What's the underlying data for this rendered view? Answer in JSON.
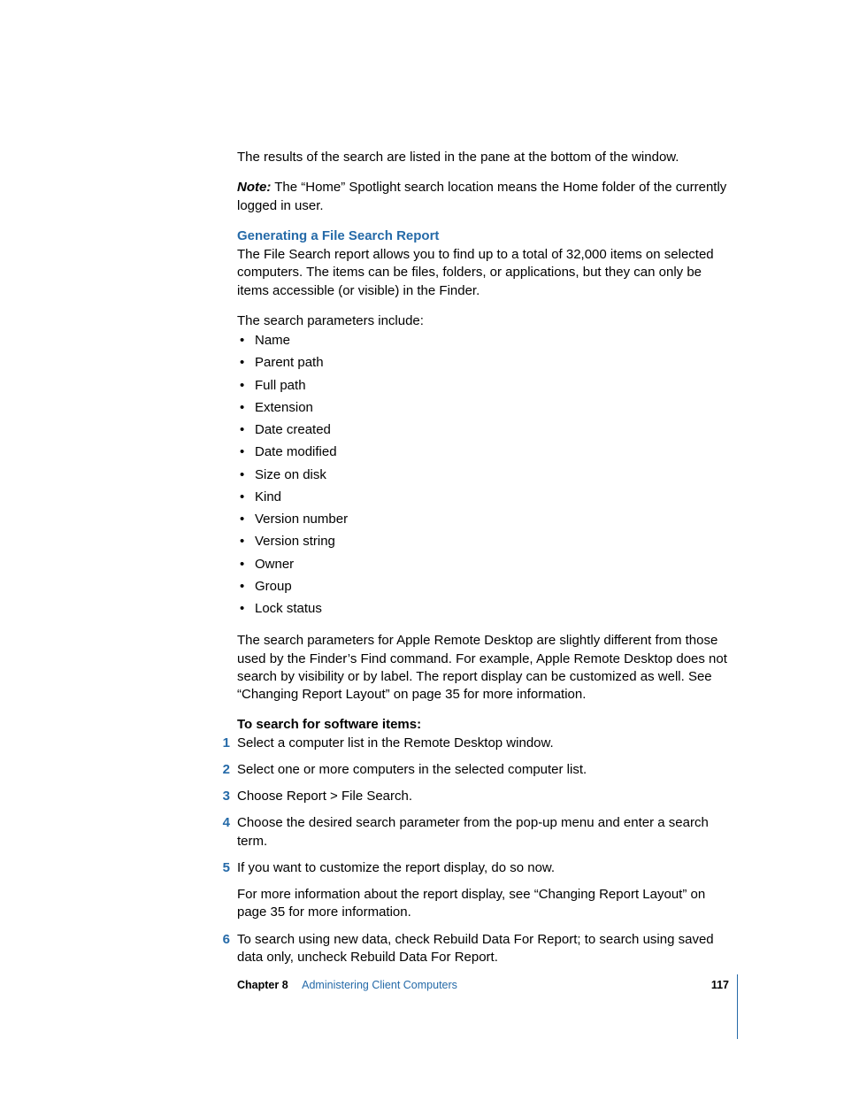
{
  "body": {
    "p1": "The results of the search are listed in the pane at the bottom of the window.",
    "note_label": "Note:",
    "note_text": "  The “Home” Spotlight search location means the Home folder of the currently logged in user.",
    "h1": "Generating a File Search Report",
    "p2": "The File Search report allows you to find up to a total of 32,000 items on selected computers. The items can be files, folders, or applications, but they can only be items accessible (or visible) in the Finder.",
    "p3": "The search parameters include:",
    "bullets": [
      "Name",
      "Parent path",
      "Full path",
      "Extension",
      "Date created",
      "Date modified",
      "Size on disk",
      "Kind",
      "Version number",
      "Version string",
      "Owner",
      "Group",
      "Lock status"
    ],
    "p4": "The search parameters for Apple Remote Desktop are slightly different from those used by the Finder’s Find command. For example, Apple Remote Desktop does not search by visibility or by label. The report display can be customized as well. See “Changing Report Layout” on page 35 for more information.",
    "subhead": "To search for software items:",
    "steps": [
      {
        "text": "Select a computer list in the Remote Desktop window."
      },
      {
        "text": "Select one or more computers in the selected computer list."
      },
      {
        "text": "Choose Report > File Search."
      },
      {
        "text": "Choose the desired search parameter from the pop-up menu and enter a search term."
      },
      {
        "text": "If you want to customize the report display, do so now.",
        "sub": "For more information about the report display, see “Changing Report Layout” on page 35 for more information."
      },
      {
        "text": "To search using new data, check Rebuild Data For Report; to search using saved data only, uncheck Rebuild Data For Report."
      }
    ]
  },
  "footer": {
    "chapter": "Chapter 8",
    "title": "Administering Client Computers",
    "page": "117"
  }
}
